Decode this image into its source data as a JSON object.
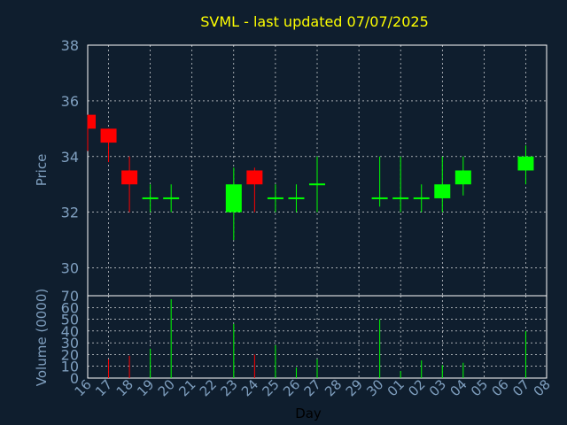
{
  "chart_data": {
    "type": "candlestick",
    "title": "SVML - last updated 07/07/2025",
    "price_axis": {
      "label": "Price",
      "ylim": [
        29,
        38
      ],
      "ticks": [
        30,
        32,
        34,
        36,
        38
      ]
    },
    "volume_axis": {
      "label": "Volume (0000)",
      "ylim": [
        0,
        70
      ],
      "ticks": [
        0,
        10,
        20,
        30,
        40,
        50,
        60,
        70
      ]
    },
    "xlabel": "Day",
    "x_ticks": [
      "16",
      "17",
      "18",
      "19",
      "20",
      "21",
      "22",
      "23",
      "24",
      "25",
      "26",
      "27",
      "28",
      "29",
      "30",
      "01",
      "02",
      "03",
      "04",
      "05",
      "06",
      "07",
      "08"
    ],
    "grid": true,
    "colors": {
      "up": "#00ff00",
      "down": "#ff0000",
      "background": "#0f1e2e",
      "grid": "#ffffff",
      "text": "#7f9fbf",
      "title": "#ffff00"
    },
    "candles": [
      {
        "day": "16",
        "open": 35.5,
        "high": 35.5,
        "low": 34.2,
        "close": 35.0
      },
      {
        "day": "17",
        "open": 35.0,
        "high": 35.0,
        "low": 33.8,
        "close": 34.5
      },
      {
        "day": "18",
        "open": 33.5,
        "high": 34.0,
        "low": 32.0,
        "close": 33.0
      },
      {
        "day": "19",
        "open": 32.5,
        "high": 33.0,
        "low": 32.0,
        "close": 32.5
      },
      {
        "day": "20",
        "open": 32.5,
        "high": 33.0,
        "low": 32.0,
        "close": 32.5
      },
      {
        "day": "23",
        "open": 32.0,
        "high": 33.6,
        "low": 31.0,
        "close": 33.0
      },
      {
        "day": "24",
        "open": 33.5,
        "high": 33.6,
        "low": 32.0,
        "close": 33.0
      },
      {
        "day": "25",
        "open": 32.5,
        "high": 33.0,
        "low": 32.0,
        "close": 32.5
      },
      {
        "day": "26",
        "open": 32.5,
        "high": 33.0,
        "low": 32.0,
        "close": 32.5
      },
      {
        "day": "27",
        "open": 33.0,
        "high": 34.0,
        "low": 32.0,
        "close": 33.0
      },
      {
        "day": "30",
        "open": 32.5,
        "high": 34.0,
        "low": 32.2,
        "close": 32.5
      },
      {
        "day": "01",
        "open": 32.5,
        "high": 34.0,
        "low": 32.0,
        "close": 32.5
      },
      {
        "day": "02",
        "open": 32.5,
        "high": 33.0,
        "low": 32.0,
        "close": 32.5
      },
      {
        "day": "03",
        "open": 32.5,
        "high": 34.0,
        "low": 32.0,
        "close": 33.0
      },
      {
        "day": "04",
        "open": 33.0,
        "high": 34.0,
        "low": 32.6,
        "close": 33.5
      },
      {
        "day": "07",
        "open": 33.5,
        "high": 34.4,
        "low": 33.0,
        "close": 34.0
      }
    ],
    "volumes": [
      {
        "day": "17",
        "value": 16,
        "dir": "down"
      },
      {
        "day": "18",
        "value": 19,
        "dir": "down"
      },
      {
        "day": "19",
        "value": 25,
        "dir": "up"
      },
      {
        "day": "20",
        "value": 67,
        "dir": "up"
      },
      {
        "day": "23",
        "value": 46,
        "dir": "up"
      },
      {
        "day": "24",
        "value": 20,
        "dir": "down"
      },
      {
        "day": "25",
        "value": 28,
        "dir": "up"
      },
      {
        "day": "26",
        "value": 9,
        "dir": "up"
      },
      {
        "day": "27",
        "value": 16,
        "dir": "up"
      },
      {
        "day": "30",
        "value": 50,
        "dir": "up"
      },
      {
        "day": "01",
        "value": 6,
        "dir": "up"
      },
      {
        "day": "02",
        "value": 15,
        "dir": "up"
      },
      {
        "day": "03",
        "value": 11,
        "dir": "up"
      },
      {
        "day": "04",
        "value": 13,
        "dir": "up"
      },
      {
        "day": "07",
        "value": 40,
        "dir": "up"
      }
    ]
  }
}
